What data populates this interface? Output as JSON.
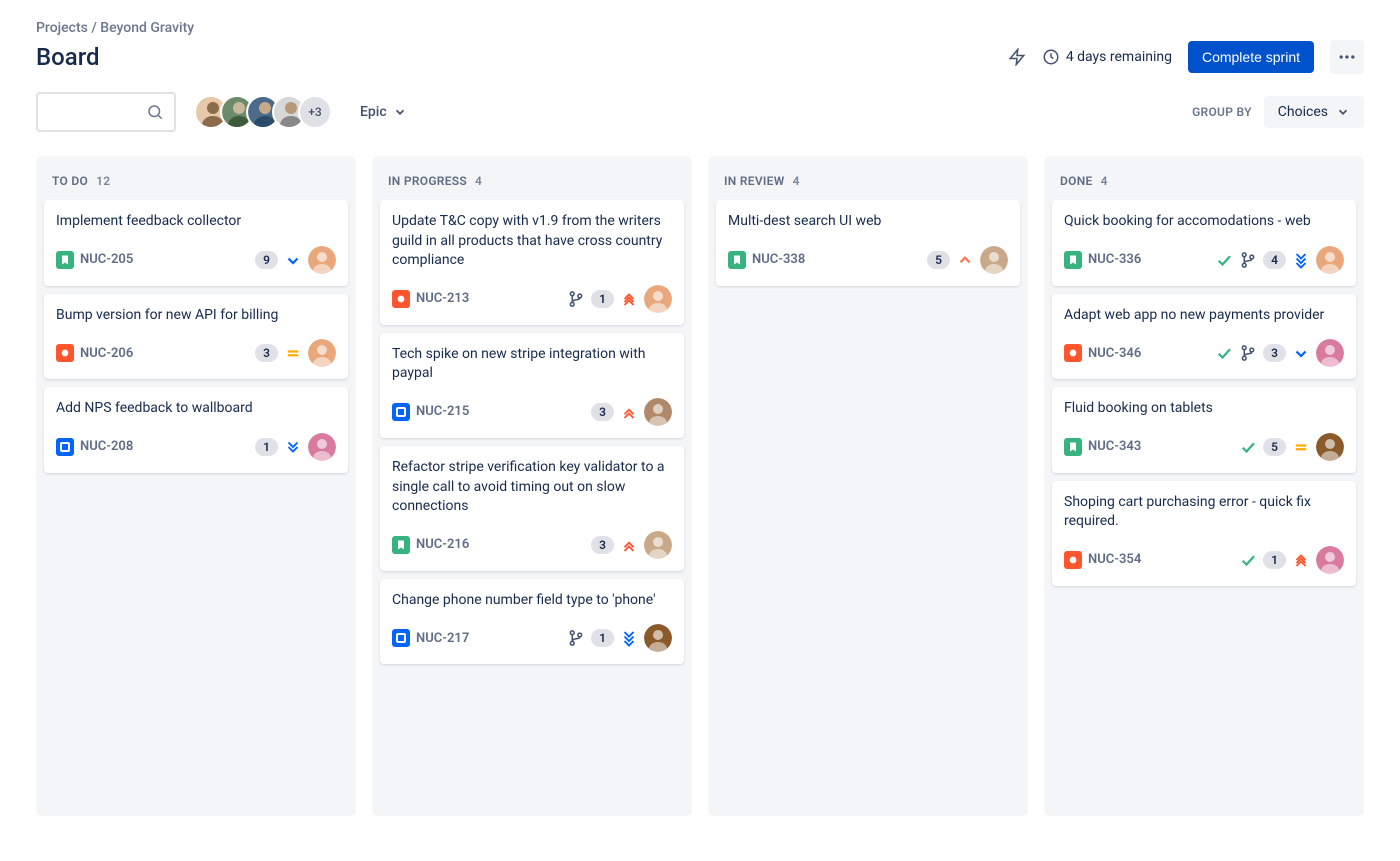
{
  "breadcrumb": {
    "root": "Projects",
    "project": "Beyond Gravity"
  },
  "title": "Board",
  "header": {
    "days_remaining": "4 days remaining",
    "complete_sprint": "Complete sprint"
  },
  "filters": {
    "epic_label": "Epic",
    "group_by_label": "GROUP BY",
    "choices_label": "Choices",
    "avatar_extra": "+3",
    "avatars": [
      "a",
      "b",
      "c",
      "d"
    ]
  },
  "columns": [
    {
      "name": "TO DO",
      "count": "12",
      "cards": [
        {
          "title": "Implement feedback collector",
          "key": "NUC-205",
          "type": "story",
          "count": "9",
          "priority": "low",
          "avatar_color": "#e8a87c"
        },
        {
          "title": "Bump version for new API for billing",
          "key": "NUC-206",
          "type": "bug",
          "count": "3",
          "priority": "medium",
          "avatar_color": "#e8a87c"
        },
        {
          "title": "Add NPS feedback to wallboard",
          "key": "NUC-208",
          "type": "task",
          "count": "1",
          "priority": "lowest",
          "avatar_color": "#d97b9e"
        }
      ]
    },
    {
      "name": "IN PROGRESS",
      "count": "4",
      "cards": [
        {
          "title": "Update T&C copy with v1.9 from the writers guild in all products that have cross country compliance",
          "key": "NUC-213",
          "type": "bug",
          "branch": true,
          "count": "1",
          "priority": "highest",
          "avatar_color": "#e8a87c"
        },
        {
          "title": "Tech spike on new stripe integration with paypal",
          "key": "NUC-215",
          "type": "task",
          "count": "3",
          "priority": "high",
          "avatar_color": "#b08968"
        },
        {
          "title": "Refactor stripe verification key validator to a single call to avoid timing out on slow connections",
          "key": "NUC-216",
          "type": "story",
          "count": "3",
          "priority": "high",
          "avatar_color": "#c9a989"
        },
        {
          "title": "Change phone number field type to 'phone'",
          "key": "NUC-217",
          "type": "task",
          "branch": true,
          "count": "1",
          "priority": "lowest-blue",
          "avatar_color": "#8b5a2b"
        }
      ]
    },
    {
      "name": "IN REVIEW",
      "count": "4",
      "cards": [
        {
          "title": "Multi-dest search UI web",
          "key": "NUC-338",
          "type": "story",
          "count": "5",
          "priority": "high-single",
          "avatar_color": "#c9a989"
        }
      ]
    },
    {
      "name": "DONE",
      "count": "4",
      "cards": [
        {
          "title": "Quick booking for accomodations - web",
          "key": "NUC-336",
          "type": "story",
          "done": true,
          "branch": true,
          "count": "4",
          "priority": "lowest-blue",
          "avatar_color": "#e8a87c"
        },
        {
          "title": "Adapt web app no new payments provider",
          "key": "NUC-346",
          "type": "bug",
          "done": true,
          "branch": true,
          "count": "3",
          "priority": "low",
          "avatar_color": "#d97b9e"
        },
        {
          "title": "Fluid booking on tablets",
          "key": "NUC-343",
          "type": "story",
          "done": true,
          "count": "5",
          "priority": "medium",
          "avatar_color": "#8b5a2b"
        },
        {
          "title": "Shoping cart purchasing error - quick fix required.",
          "key": "NUC-354",
          "type": "bug",
          "done": true,
          "count": "1",
          "priority": "highest",
          "avatar_color": "#d97b9e"
        }
      ]
    }
  ]
}
